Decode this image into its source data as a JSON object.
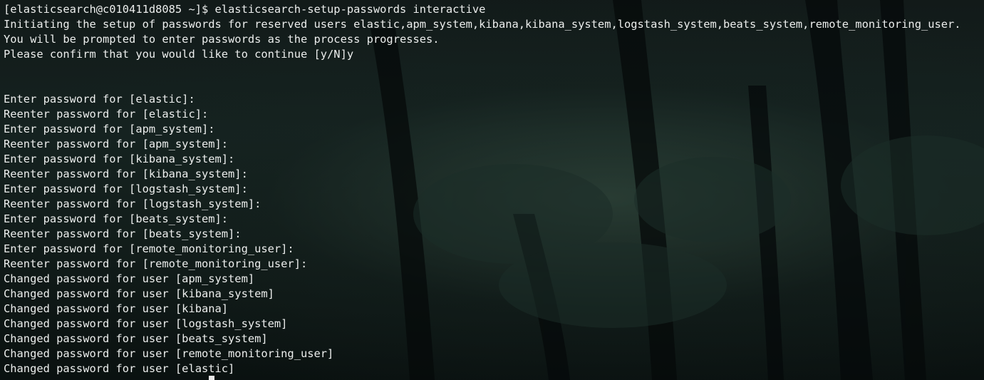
{
  "terminal": {
    "lines": [
      "[elasticsearch@c010411d8085 ~]$ elasticsearch-setup-passwords interactive",
      "Initiating the setup of passwords for reserved users elastic,apm_system,kibana,kibana_system,logstash_system,beats_system,remote_monitoring_user.",
      "You will be prompted to enter passwords as the process progresses.",
      "Please confirm that you would like to continue [y/N]y",
      "",
      "",
      "Enter password for [elastic]:",
      "Reenter password for [elastic]:",
      "Enter password for [apm_system]:",
      "Reenter password for [apm_system]:",
      "Enter password for [kibana_system]:",
      "Reenter password for [kibana_system]:",
      "Enter password for [logstash_system]:",
      "Reenter password for [logstash_system]:",
      "Enter password for [beats_system]:",
      "Reenter password for [beats_system]:",
      "Enter password for [remote_monitoring_user]:",
      "Reenter password for [remote_monitoring_user]:",
      "Changed password for user [apm_system]",
      "Changed password for user [kibana_system]",
      "Changed password for user [kibana]",
      "Changed password for user [logstash_system]",
      "Changed password for user [beats_system]",
      "Changed password for user [remote_monitoring_user]",
      "Changed password for user [elastic]"
    ]
  }
}
